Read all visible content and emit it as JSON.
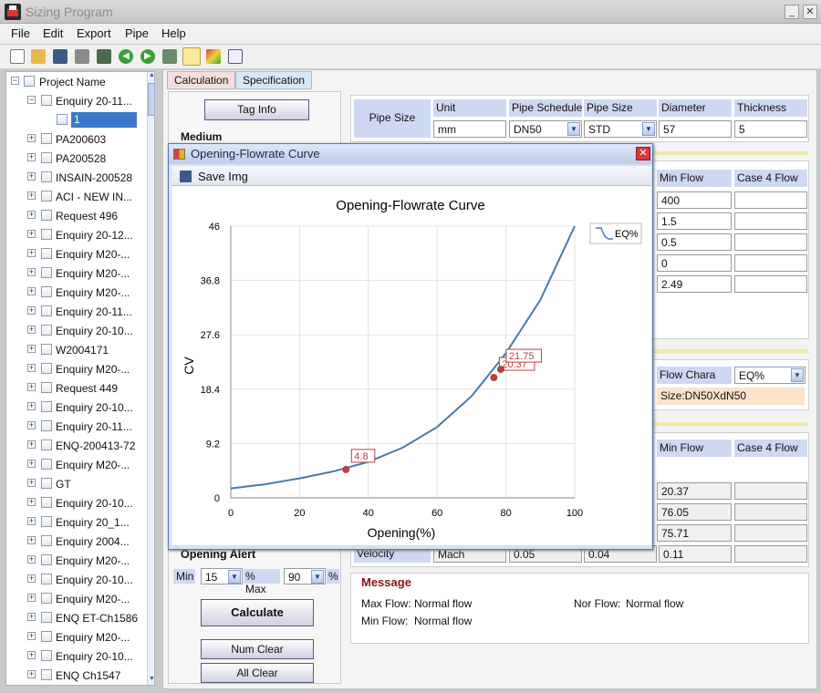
{
  "window": {
    "title": "Sizing Program",
    "min": "_",
    "close": "✕"
  },
  "menu": [
    "File",
    "Edit",
    "Export",
    "Pipe",
    "Help"
  ],
  "toolbar_icons": [
    "new-icon",
    "open-icon",
    "save-icon",
    "print-icon",
    "save-as-icon",
    "back-icon",
    "forward-icon",
    "export-icon",
    "chart-icon",
    "color-icon",
    "edit-icon"
  ],
  "tree": {
    "header": "Project Name",
    "children": [
      "Enquiry 20-11...",
      "1",
      "PA200603",
      "PA200528",
      "INSAIN-200528",
      "ACI - NEW IN...",
      "Request 496",
      "Enquiry 20-12...",
      "Enquiry M20-...",
      "Enquiry M20-...",
      "Enquiry M20-...",
      "Enquiry 20-11...",
      "Enquiry 20-10...",
      "W2004171",
      "Enquiry M20-...",
      "Request 449",
      "Enquiry 20-10...",
      "Enquiry 20-11...",
      "ENQ-200413-72",
      "Enquiry M20-...",
      "GT",
      "Enquiry 20-10...",
      "Enquiry 20_1...",
      "Enquiry 2004...",
      "Enquiry M20-...",
      "Enquiry 20-10...",
      "Enquiry M20-...",
      "ENQ ET-Ch1586",
      "Enquiry M20-...",
      "Enquiry 20-10...",
      "ENQ Ch1547"
    ]
  },
  "tabs": [
    "Calculation",
    "Specification"
  ],
  "left_panel": {
    "tag_info": "Tag Info",
    "medium": "Medium",
    "opening_alert": "Opening Alert",
    "min_label": "Min",
    "min_value": "15",
    "pct_max": "% Max",
    "max_value": "90",
    "pct": "%",
    "calculate": "Calculate",
    "num_clear": "Num Clear",
    "all_clear": "All Clear"
  },
  "pipe": {
    "label": "Pipe Size",
    "headers": [
      "Unit",
      "Pipe Schedule",
      "Pipe Size",
      "Diameter",
      "Thickness"
    ],
    "values": [
      "mm",
      "DN50",
      "STD",
      "57",
      "5"
    ]
  },
  "flow_table": {
    "headers": [
      "Min Flow",
      "Case 4 Flow"
    ],
    "min_flow": [
      "400",
      "1.5",
      "0.5",
      "0",
      "2.49"
    ]
  },
  "valve": {
    "flow_chara_label": "Flow Chara",
    "flow_chara_value": "EQ%",
    "size": "Size:DN50XdN50"
  },
  "result_table": {
    "headers": [
      "Min Flow",
      "Case 4 Flow"
    ],
    "values": [
      "20.37",
      "76.05",
      "75.71"
    ],
    "velocity_label": "Velocity",
    "velocity_unit": "Mach",
    "velocity_values": [
      "0.05",
      "0.04",
      "0.11"
    ]
  },
  "message": {
    "title": "Message",
    "max_flow_label": "Max Flow:",
    "max_flow": "Normal flow",
    "nor_flow_label": "Nor Flow:",
    "nor_flow": "Normal flow",
    "min_flow_label": "Min Flow:",
    "min_flow": "Normal flow"
  },
  "dialog": {
    "title": "Opening-Flowrate Curve",
    "save_img": "Save Img",
    "close": "✕"
  },
  "chart_data": {
    "type": "line",
    "title": "Opening-Flowrate Curve",
    "xlabel": "Opening(%)",
    "ylabel": "CV",
    "xlim": [
      0,
      100
    ],
    "ylim": [
      0,
      46
    ],
    "xticks": [
      "0",
      "20",
      "40",
      "60",
      "80",
      "100"
    ],
    "yticks": [
      "0",
      "9.2",
      "18.4",
      "27.6",
      "36.8",
      "46"
    ],
    "series": [
      {
        "name": "EQ%",
        "x": [
          0,
          10,
          20,
          30,
          40,
          50,
          60,
          70,
          80,
          90,
          100
        ],
        "y": [
          1.6,
          2.3,
          3.3,
          4.5,
          6.1,
          8.5,
          12,
          17.2,
          24.5,
          33.5,
          46
        ]
      }
    ],
    "points": [
      {
        "x": 33.5,
        "y": 4.8,
        "label": "4.8"
      },
      {
        "x": 76.5,
        "y": 20.37,
        "label": "20.37"
      },
      {
        "x": 78.5,
        "y": 21.75,
        "label": "21.75"
      }
    ],
    "legend": "top-right",
    "grid": true,
    "colors": {
      "line": "#4a7aaa",
      "point": "#b84040"
    }
  }
}
